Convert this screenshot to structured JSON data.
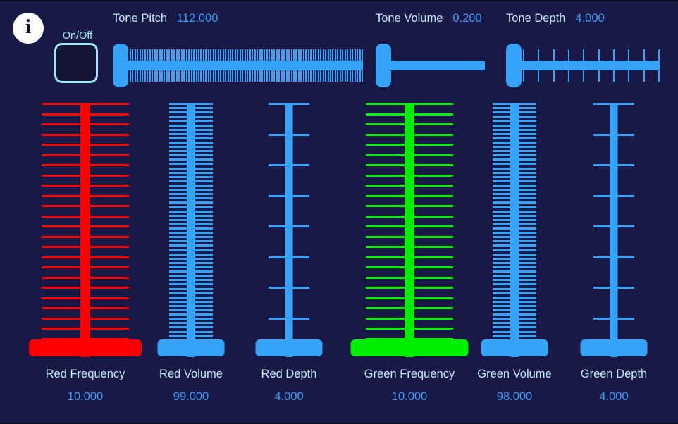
{
  "window": {
    "background_color": "#191947",
    "accent_blue": "#35a3f7",
    "label_color": "#bfe8f5",
    "value_color": "#3b9cf5",
    "red_color": "#ff0000",
    "green_color": "#00ee00",
    "onoff_border_color": "#9fe9f7"
  },
  "info_button": {
    "icon": "info-icon",
    "glyph": "i"
  },
  "power": {
    "label": "On/Off",
    "state": "off"
  },
  "tone_sliders": [
    {
      "name": "tone-pitch",
      "label": "Tone Pitch",
      "value": "112.000",
      "value_number": 112.0,
      "orientation": "horizontal",
      "handle_position_pct": 0,
      "tick_count": 96,
      "track_color": "#35a3f7"
    },
    {
      "name": "tone-volume",
      "label": "Tone Volume",
      "value": "0.200",
      "value_number": 0.2,
      "orientation": "horizontal",
      "handle_position_pct": 0,
      "tick_count": 0,
      "track_color": "#35a3f7"
    },
    {
      "name": "tone-depth",
      "label": "Tone Depth",
      "value": "4.000",
      "value_number": 4.0,
      "orientation": "horizontal",
      "handle_position_pct": 0,
      "tick_count": 10,
      "track_color": "#35a3f7"
    }
  ],
  "channel_sliders": [
    {
      "name": "red-frequency",
      "label": "Red Frequency",
      "value": "10.000",
      "value_number": 10.0,
      "orientation": "vertical",
      "color": "#ff0000",
      "tick_count": 25,
      "tick_width": 124,
      "track_width": 14,
      "handle_width": 160,
      "handle_position_pct": 0
    },
    {
      "name": "red-volume",
      "label": "Red Volume",
      "value": "99.000",
      "value_number": 99.0,
      "orientation": "vertical",
      "color": "#35a3f7",
      "tick_count": 58,
      "tick_width": 62,
      "track_width": 12,
      "handle_width": 95,
      "handle_position_pct": 0
    },
    {
      "name": "red-depth",
      "label": "Red Depth",
      "value": "4.000",
      "value_number": 4.0,
      "orientation": "vertical",
      "color": "#35a3f7",
      "tick_count": 9,
      "tick_width": 58,
      "track_width": 11,
      "handle_width": 95,
      "handle_position_pct": 0
    },
    {
      "name": "green-frequency",
      "label": "Green Frequency",
      "value": "10.000",
      "value_number": 10.0,
      "orientation": "vertical",
      "color": "#00ee00",
      "tick_count": 25,
      "tick_width": 124,
      "track_width": 14,
      "handle_width": 167,
      "handle_position_pct": 0
    },
    {
      "name": "green-volume",
      "label": "Green Volume",
      "value": "98.000",
      "value_number": 98.0,
      "orientation": "vertical",
      "color": "#35a3f7",
      "tick_count": 58,
      "tick_width": 62,
      "track_width": 12,
      "handle_width": 95,
      "handle_position_pct": 0
    },
    {
      "name": "green-depth",
      "label": "Green Depth",
      "value": "4.000",
      "value_number": 4.0,
      "orientation": "vertical",
      "color": "#35a3f7",
      "tick_count": 9,
      "tick_width": 58,
      "track_width": 11,
      "handle_width": 95,
      "handle_position_pct": 0
    }
  ]
}
